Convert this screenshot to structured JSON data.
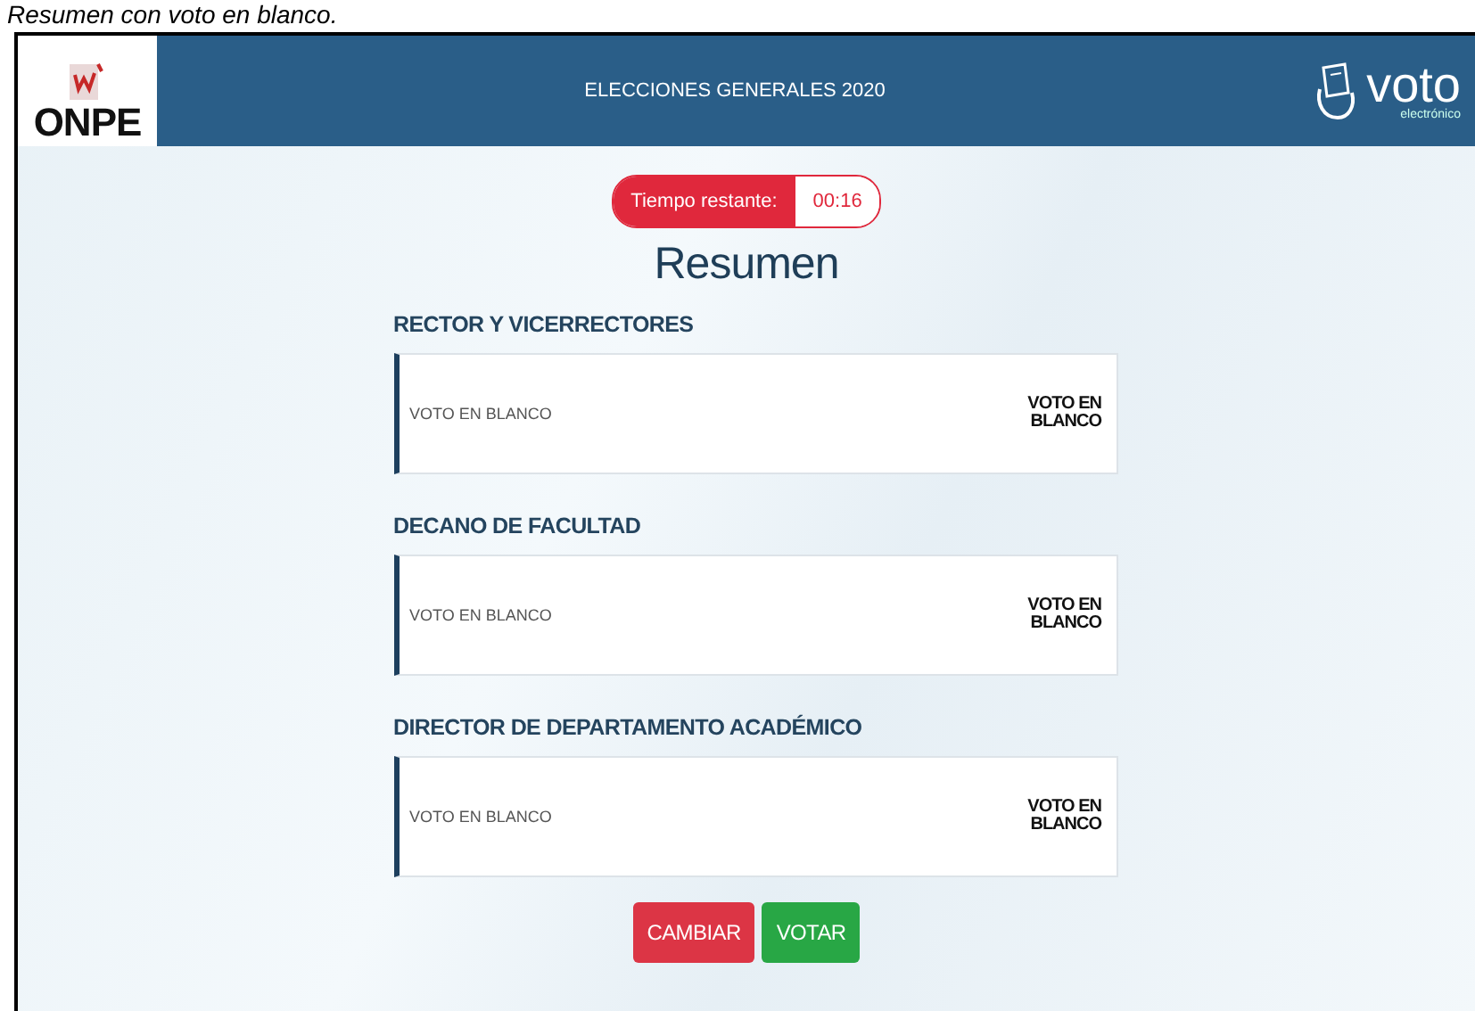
{
  "caption": "Resumen con voto en blanco.",
  "header": {
    "logo_text": "ONPE",
    "title": "ELECCIONES GENERALES 2020",
    "brand_text": "voto",
    "brand_subtext": "electrónico"
  },
  "timer": {
    "label": "Tiempo restante:",
    "value": "00:16"
  },
  "heading": "Resumen",
  "sections": [
    {
      "title": "RECTOR Y VICERRECTORES",
      "choice": "VOTO EN BLANCO",
      "mark": "VOTO EN BLANCO"
    },
    {
      "title": "DECANO DE FACULTAD",
      "choice": "VOTO EN BLANCO",
      "mark": "VOTO EN BLANCO"
    },
    {
      "title": "DIRECTOR DE DEPARTAMENTO ACADÉMICO",
      "choice": "VOTO EN BLANCO",
      "mark": "VOTO EN BLANCO"
    }
  ],
  "buttons": [
    {
      "label": "CAMBIAR",
      "kind": "danger"
    },
    {
      "label": "VOTAR",
      "kind": "success"
    }
  ]
}
